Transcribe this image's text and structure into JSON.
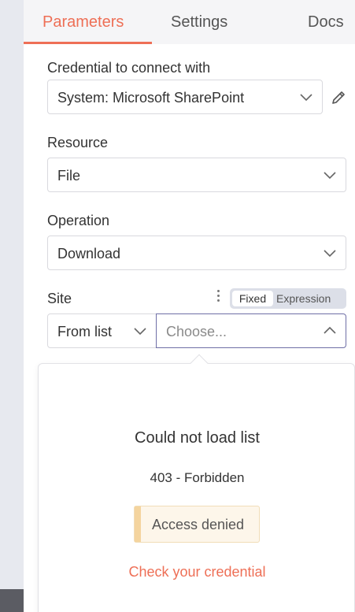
{
  "tabs": [
    {
      "label": "Parameters"
    },
    {
      "label": "Settings"
    },
    {
      "label": "Docs"
    }
  ],
  "credential": {
    "label": "Credential to connect with",
    "value": "System: Microsoft SharePoint"
  },
  "resource": {
    "label": "Resource",
    "value": "File"
  },
  "operation": {
    "label": "Operation",
    "value": "Download"
  },
  "site": {
    "label": "Site",
    "mode_fixed": "Fixed",
    "mode_expression": "Expression",
    "source_value": "From list",
    "placeholder": "Choose..."
  },
  "popup": {
    "title": "Could not load list",
    "subtitle": "403 - Forbidden",
    "notice": "Access denied",
    "link": "Check your credential"
  },
  "colors": {
    "accent": "#ee6f56",
    "warning_bg": "#fdf6ea",
    "warning_bar": "#f4d49e",
    "focus_border": "#6f6fa6"
  },
  "icons": {
    "edit": "pencil-icon",
    "dropdown": "chevron-down-icon",
    "open": "chevron-up-icon",
    "options": "kebab-icon"
  }
}
